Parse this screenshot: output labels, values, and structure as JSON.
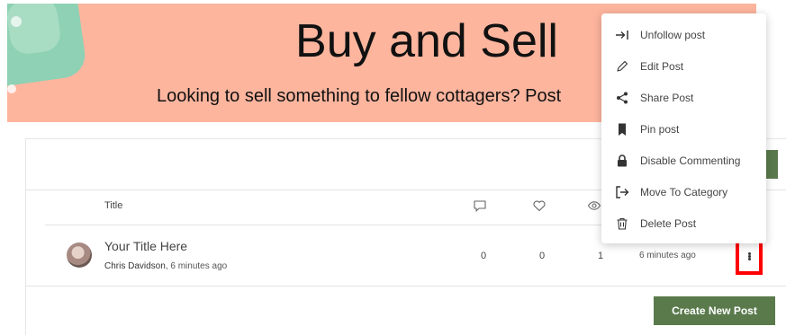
{
  "banner": {
    "title": "Buy and Sell",
    "subtitle": "Looking to sell something to fellow cottagers? Post"
  },
  "table": {
    "header_title": "Title",
    "header_icons": [
      "comment-icon",
      "heart-icon",
      "eye-icon"
    ]
  },
  "post": {
    "title": "Your Title Here",
    "author": "Chris Davidson",
    "author_time": ", 6 minutes ago",
    "comments": "0",
    "likes": "0",
    "views": "1",
    "time": "6 minutes ago"
  },
  "actions": {
    "create_label": "Create New Post"
  },
  "menu": {
    "items": [
      {
        "label": "Unfollow post",
        "icon": "unfollow-icon"
      },
      {
        "label": "Edit Post",
        "icon": "pencil-icon"
      },
      {
        "label": "Share Post",
        "icon": "share-icon"
      },
      {
        "label": "Pin post",
        "icon": "bookmark-icon"
      },
      {
        "label": "Disable Commenting",
        "icon": "lock-icon"
      },
      {
        "label": "Move To Category",
        "icon": "move-icon"
      },
      {
        "label": "Delete Post",
        "icon": "trash-icon"
      }
    ]
  },
  "colors": {
    "banner": "#fdb59e",
    "accent_green": "#5a7a4c",
    "highlight": "#ff0000"
  }
}
